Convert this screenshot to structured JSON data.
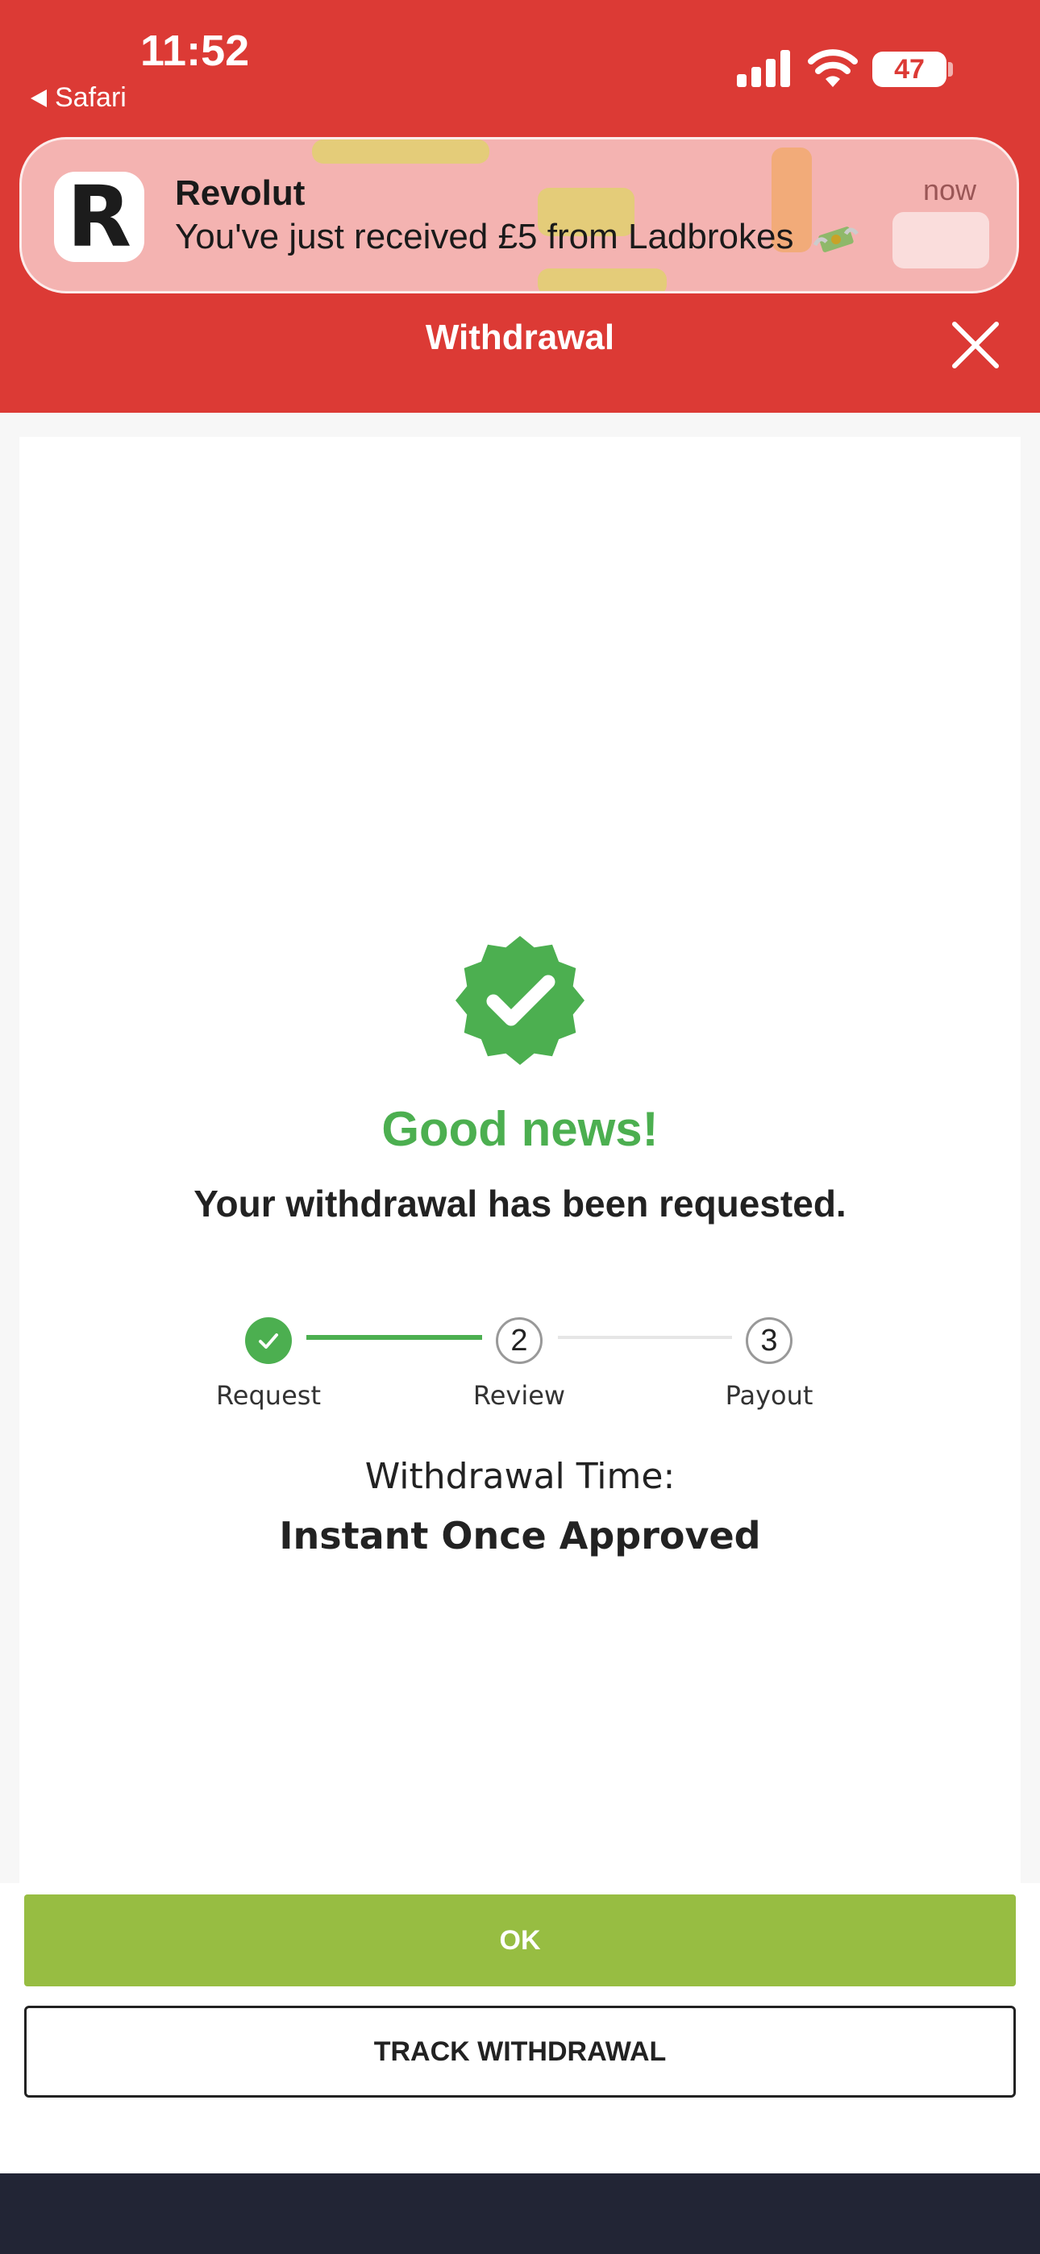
{
  "status_bar": {
    "time": "11:52",
    "back_app": "Safari",
    "battery": "47",
    "battery_level": 0.47,
    "icons": [
      "signal-icon",
      "wifi-icon",
      "battery-icon"
    ]
  },
  "notification": {
    "app": "Revolut",
    "message": "You've just received £5 from Ladbrokes",
    "time": "now",
    "icon": "revolut-logo-icon",
    "emoji": "money-with-wings-icon"
  },
  "header": {
    "title": "Withdrawal",
    "close_icon": "close-icon"
  },
  "confirmation": {
    "icon": "verified-check-badge-icon",
    "heading": "Good news!",
    "message": "Your withdrawal has been requested."
  },
  "steps": [
    {
      "number": "1",
      "label": "Request",
      "state": "done"
    },
    {
      "number": "2",
      "label": "Review",
      "state": "pending"
    },
    {
      "number": "3",
      "label": "Payout",
      "state": "pending"
    }
  ],
  "withdrawal_time": {
    "label": "Withdrawal Time:",
    "value": "Instant Once Approved"
  },
  "buttons": {
    "ok": "OK",
    "track": "TRACK WITHDRAWAL"
  },
  "colors": {
    "header_red": "#dc3a35",
    "success_green": "#4caf50",
    "ok_button": "#97bd42",
    "bottom_bar": "#222535"
  }
}
